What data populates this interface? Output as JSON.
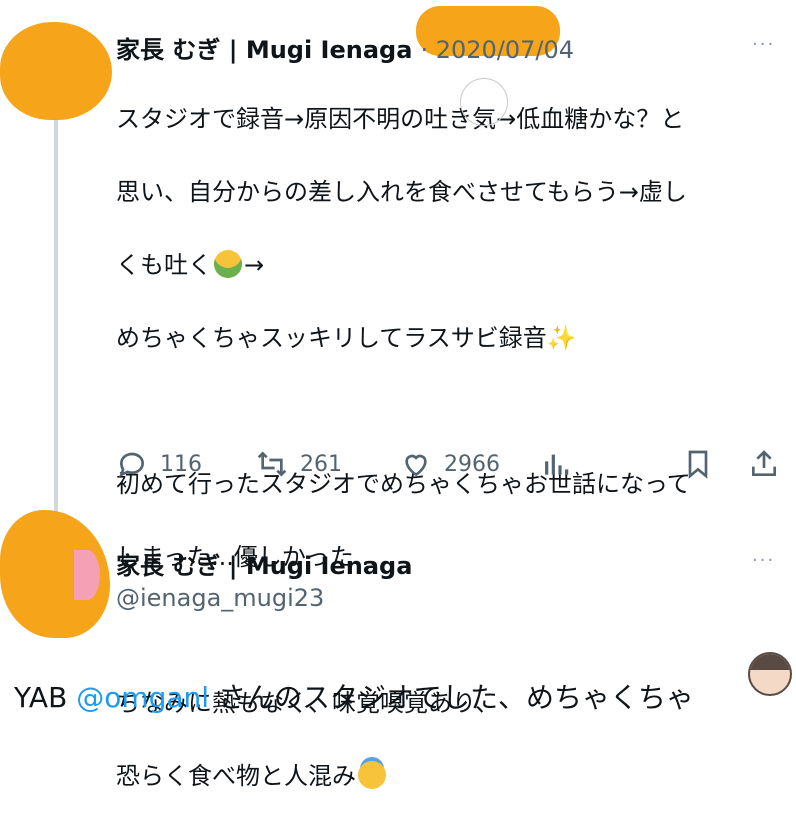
{
  "tweet1": {
    "display_name": "家長 むぎ | Mugi Ienaga",
    "handle_date": "· 2020/07/04",
    "text_lines": [
      "スタジオで録音→原因不明の吐き気→低血糖かな？と",
      "思い、自分からの差し入れを食べさせてもらう→虚し",
      "くも吐く",
      "めちゃくちゃスッキリしてラスサビ録音",
      "",
      "初めて行ったスタジオでめちゃくちゃお世話になって",
      "しまった...優しかった...",
      "",
      "ちなみに熱もなく、味覚嗅覚あり、",
      "恐らく食べ物と人混み"
    ],
    "arrow_after_vomit": "→",
    "sparkle": "✨",
    "actions": {
      "reply_count": "116",
      "retweet_count": "261",
      "like_count": "2966"
    },
    "more": "···"
  },
  "tweet2": {
    "display_name": "家長 むぎ | Mugi Ienaga",
    "handle": "@ienaga_mugi23",
    "more": "···",
    "text_start": "YAB ",
    "mention": "@omganl",
    "text_rest": " さんのスタジオでした、めちゃくちゃ"
  },
  "colors": {
    "text": "#0f1419",
    "secondary": "#536471",
    "accent": "#1d9bf0",
    "redaction": "#f6a51b",
    "thread_line": "#cfd9de"
  },
  "icons": [
    "reply-icon",
    "retweet-icon",
    "like-icon",
    "analytics-icon",
    "bookmark-icon",
    "share-icon"
  ]
}
